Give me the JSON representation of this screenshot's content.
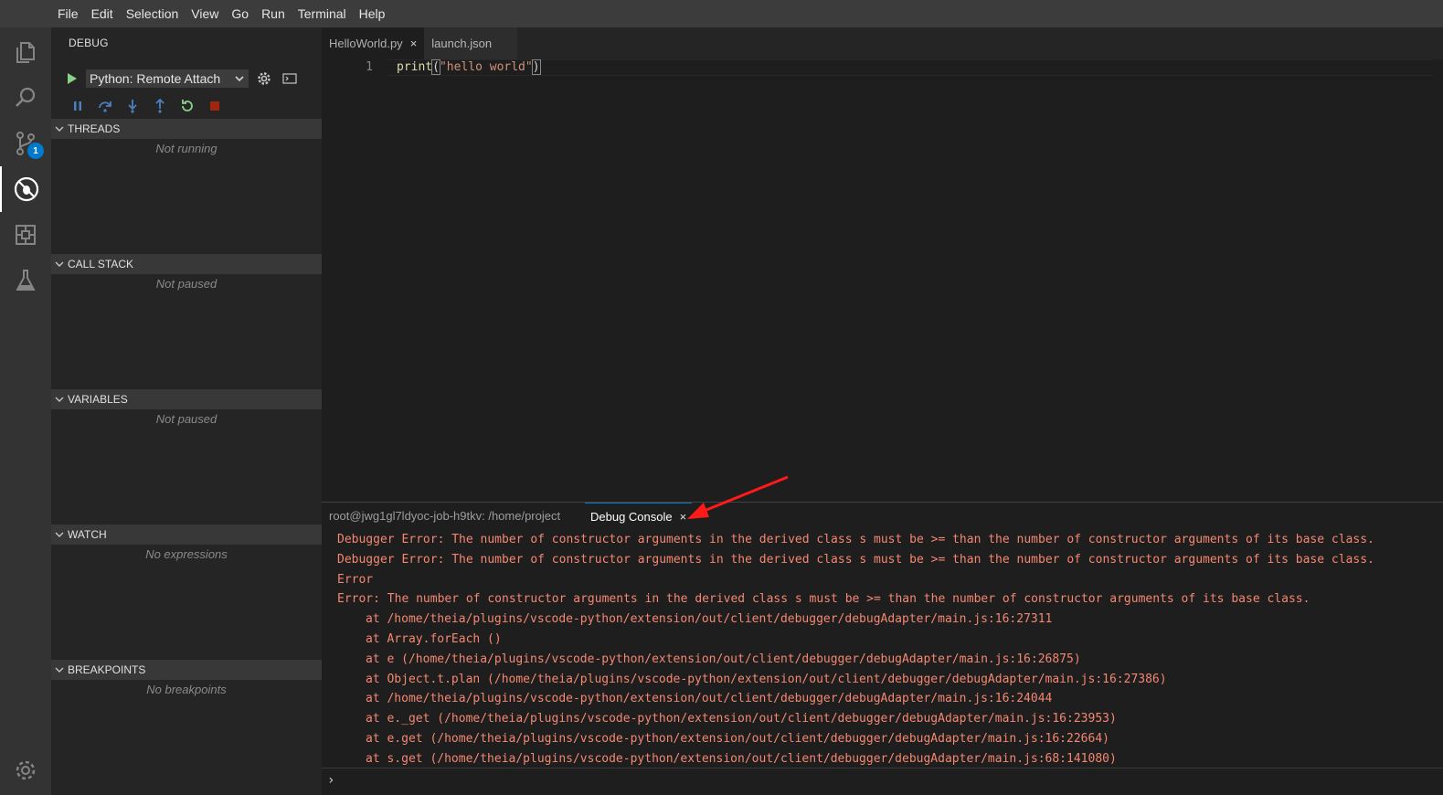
{
  "menu": [
    "File",
    "Edit",
    "Selection",
    "View",
    "Go",
    "Run",
    "Terminal",
    "Help"
  ],
  "activity": {
    "icons": [
      "explorer-icon",
      "search-icon",
      "source-control-icon",
      "debug-icon",
      "extensions-icon",
      "test-flask-icon",
      "settings-gear-icon"
    ],
    "scm_badge": "1"
  },
  "sidebar": {
    "title": "DEBUG",
    "config": "Python: Remote Attach",
    "sections": [
      {
        "header": "THREADS",
        "empty": "Not running"
      },
      {
        "header": "CALL STACK",
        "empty": "Not paused"
      },
      {
        "header": "VARIABLES",
        "empty": "Not paused"
      },
      {
        "header": "WATCH",
        "empty": "No expressions"
      },
      {
        "header": "BREAKPOINTS",
        "empty": "No breakpoints"
      }
    ]
  },
  "editor": {
    "tabs": [
      {
        "label": "HelloWorld.py",
        "close": "×"
      },
      {
        "label": "launch.json"
      }
    ],
    "line_number": "1",
    "code": {
      "fn": "print",
      "open": "(",
      "str": "\"hello world\"",
      "close": ")"
    }
  },
  "panel": {
    "terminal_tab": "root@jwg1gl7ldyoc-job-h9tkv: /home/project",
    "debug_tab": "Debug Console",
    "close": "×",
    "lines": [
      "Debugger Error: The number of constructor arguments in the derived class s must be >= than the number of constructor arguments of its base class.",
      "Debugger Error: The number of constructor arguments in the derived class s must be >= than the number of constructor arguments of its base class.",
      "Error",
      "Error: The number of constructor arguments in the derived class s must be >= than the number of constructor arguments of its base class.",
      "at /home/theia/plugins/vscode-python/extension/out/client/debugger/debugAdapter/main.js:16:27311",
      "at Array.forEach ()",
      "at e (/home/theia/plugins/vscode-python/extension/out/client/debugger/debugAdapter/main.js:16:26875)",
      "at Object.t.plan (/home/theia/plugins/vscode-python/extension/out/client/debugger/debugAdapter/main.js:16:27386)",
      "at /home/theia/plugins/vscode-python/extension/out/client/debugger/debugAdapter/main.js:16:24044",
      "at e._get (/home/theia/plugins/vscode-python/extension/out/client/debugger/debugAdapter/main.js:16:23953)",
      "at e.get (/home/theia/plugins/vscode-python/extension/out/client/debugger/debugAdapter/main.js:16:22664)",
      "at s.get (/home/theia/plugins/vscode-python/extension/out/client/debugger/debugAdapter/main.js:68:141080)"
    ],
    "prompt": "›"
  },
  "colors": {
    "error": "#f48771",
    "accent": "#007acc",
    "annotation_arrow": "#ff1a1a"
  }
}
